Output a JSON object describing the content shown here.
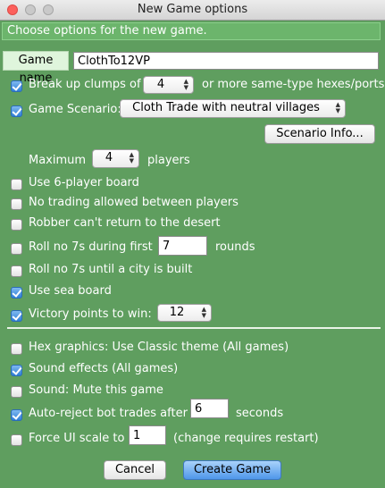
{
  "window": {
    "title": "New Game options"
  },
  "banner": "Choose options for the new game.",
  "game_name": {
    "label": "Game name",
    "value": "ClothTo12VP"
  },
  "clumps": {
    "prefix": "Break up clumps of",
    "value": "4",
    "suffix": "or more same-type hexes/ports",
    "checked": true
  },
  "scenario": {
    "label": "Game Scenario:",
    "value": "Cloth Trade with neutral villages",
    "checked": true,
    "info_button": "Scenario Info..."
  },
  "max_players": {
    "prefix": "Maximum",
    "value": "4",
    "suffix": "players"
  },
  "options": {
    "six_player": {
      "label": "Use 6-player board",
      "checked": false
    },
    "no_trading": {
      "label": "No trading allowed between players",
      "checked": false
    },
    "robber": {
      "label": "Robber can't return to the desert",
      "checked": false
    },
    "roll7": {
      "prefix": "Roll no 7s during first",
      "value": "7",
      "suffix": "rounds",
      "checked": false
    },
    "roll7_city": {
      "label": "Roll no 7s until a city is built",
      "checked": false
    },
    "sea_board": {
      "label": "Use sea board",
      "checked": true
    },
    "victory": {
      "label": "Victory points to win:",
      "value": "12",
      "checked": true
    }
  },
  "client": {
    "hex_graphics": {
      "label": "Hex graphics: Use Classic theme (All games)",
      "checked": false
    },
    "sound_effects": {
      "label": "Sound effects (All games)",
      "checked": true
    },
    "sound_mute": {
      "label": "Sound: Mute this game",
      "checked": false
    },
    "auto_reject": {
      "prefix": "Auto-reject bot trades after",
      "value": "6",
      "suffix": "seconds",
      "checked": true
    },
    "ui_scale": {
      "prefix": "Force UI scale to",
      "value": "1",
      "suffix": "(change requires restart)",
      "checked": false
    }
  },
  "buttons": {
    "cancel": "Cancel",
    "create": "Create Game"
  }
}
